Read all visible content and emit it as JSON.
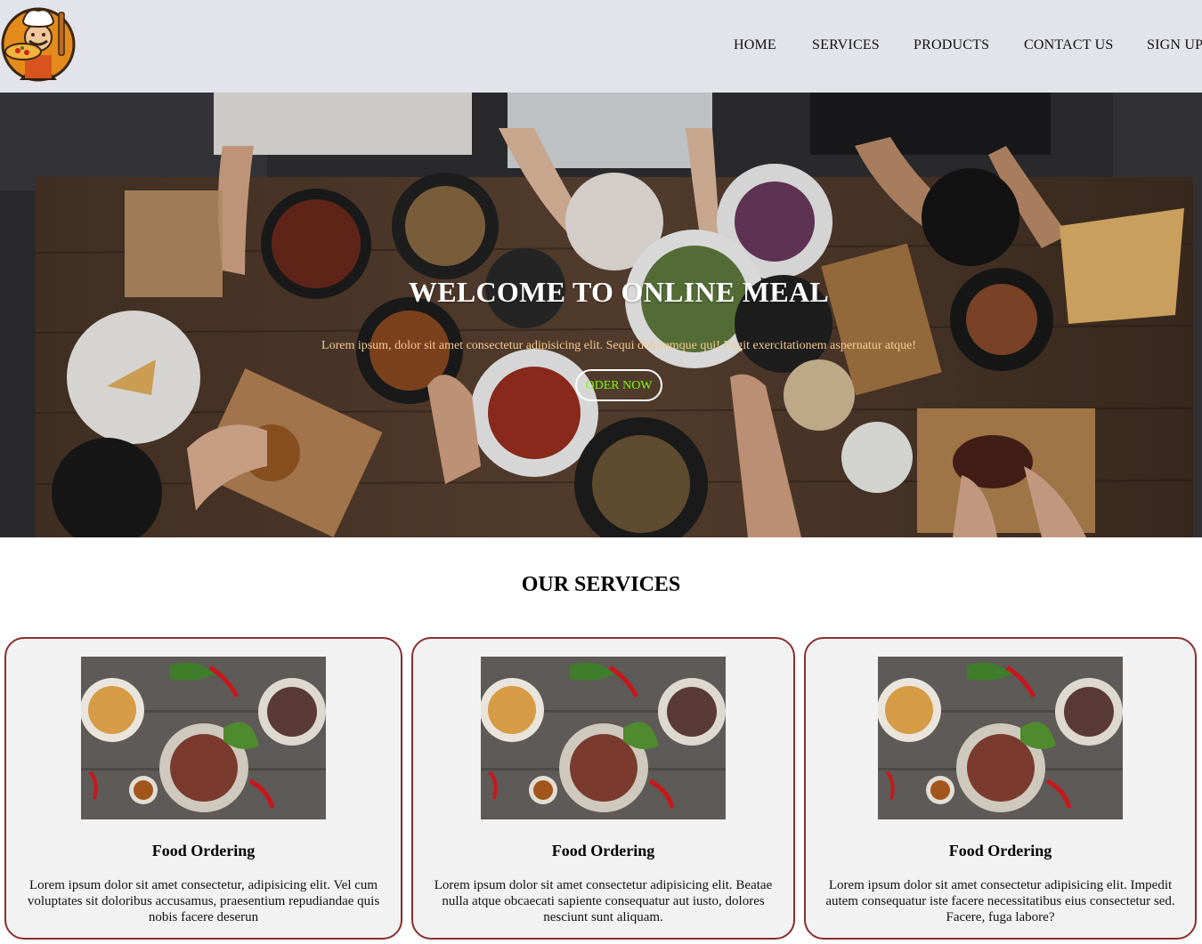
{
  "header": {
    "logo_icon": "chef-pizza-logo",
    "nav": [
      {
        "label": "HOME"
      },
      {
        "label": "SERVICES"
      },
      {
        "label": "PRODUCTS"
      },
      {
        "label": "CONTACT US"
      },
      {
        "label": "SIGN UP"
      }
    ]
  },
  "hero": {
    "title": "WELCOME TO ONLINE MEAL",
    "text": "Lorem ipsum, dolor sit amet consectetur adipisicing elit. Sequi doloremque qui! Fugit exercitationem aspernatur atque!",
    "button_label": "ODER NOW",
    "image_icon": "food-table-photo",
    "colors": {
      "text": "#f3c98f",
      "button_text": "#7cfc00"
    }
  },
  "services": {
    "title": "OUR SERVICES",
    "border_color": "#8b2e2e",
    "cards": [
      {
        "title": "Food Ordering",
        "text": "Lorem ipsum dolor sit amet consectetur, adipisicing elit. Vel cum voluptates sit doloribus accusamus, praesentium repudiandae quis nobis facere deserun",
        "image_icon": "food-plate-photo"
      },
      {
        "title": "Food Ordering",
        "text": "Lorem ipsum dolor sit amet consectetur adipisicing elit. Beatae nulla atque obcaecati sapiente consequatur aut iusto, dolores nesciunt sunt aliquam.",
        "image_icon": "food-plate-photo"
      },
      {
        "title": "Food Ordering",
        "text": "Lorem ipsum dolor sit amet consectetur adipisicing elit. Impedit autem consequatur iste facere necessitatibus eius consectetur sed. Facere, fuga labore?",
        "image_icon": "food-plate-photo"
      }
    ]
  }
}
